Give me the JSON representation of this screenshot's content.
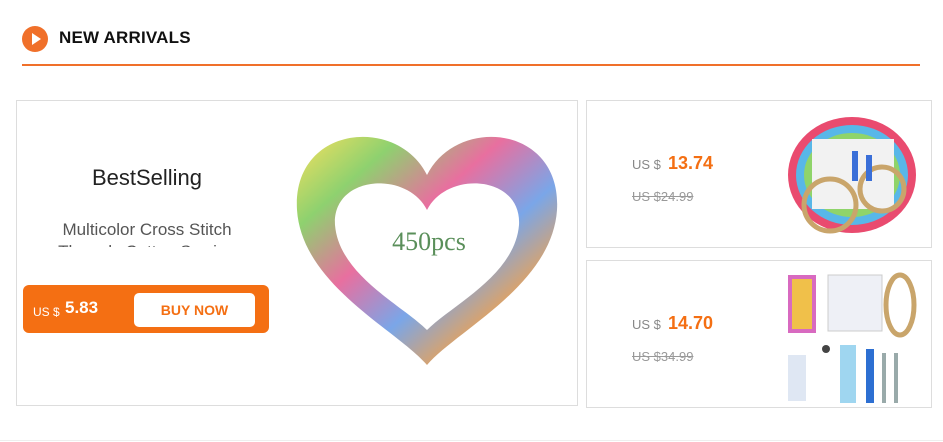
{
  "section": {
    "title": "NEW ARRIVALS",
    "icon": "play-icon",
    "accent": "#f0702a"
  },
  "featured": {
    "heading": "BestSelling",
    "product_desc": "Multicolor Cross Stitch Threads Cotton Sewing Skeins",
    "currency": "US $",
    "price": "5.83",
    "button": "BUY NOW",
    "image_text": "450pcs"
  },
  "products": [
    {
      "currency": "US $",
      "price": "13.74",
      "original": "US $24.99"
    },
    {
      "currency": "US $",
      "price": "14.70",
      "original": "US $34.99"
    }
  ]
}
